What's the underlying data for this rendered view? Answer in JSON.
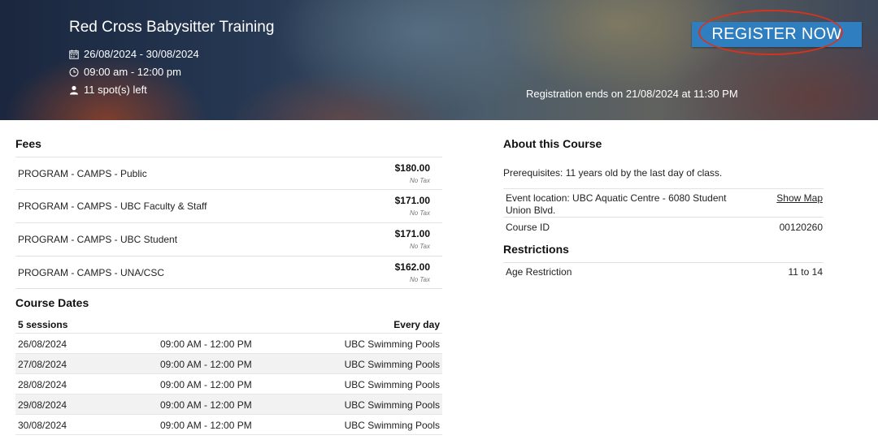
{
  "header": {
    "title": "Red Cross Babysitter Training",
    "dates": "26/08/2024 - 30/08/2024",
    "time": "09:00 am - 12:00 pm",
    "spots": "11 spot(s) left",
    "register_label": "REGISTER NOW",
    "registration_ends": "Registration ends on 21/08/2024 at 11:30 PM",
    "icons": [
      "calendar-icon",
      "clock-icon",
      "person-icon"
    ]
  },
  "fees": {
    "title": "Fees",
    "rows": [
      {
        "name": "PROGRAM - CAMPS - Public",
        "price": "$180.00",
        "tax": "No Tax"
      },
      {
        "name": "PROGRAM - CAMPS - UBC Faculty & Staff",
        "price": "$171.00",
        "tax": "No Tax"
      },
      {
        "name": "PROGRAM - CAMPS - UBC Student",
        "price": "$171.00",
        "tax": "No Tax"
      },
      {
        "name": "PROGRAM - CAMPS - UNA/CSC",
        "price": "$162.00",
        "tax": "No Tax"
      }
    ]
  },
  "course_dates": {
    "title": "Course Dates",
    "sessions": "5 sessions",
    "frequency": "Every day",
    "rows": [
      {
        "date": "26/08/2024",
        "time": "09:00 AM - 12:00 PM",
        "location": "UBC Swimming Pools"
      },
      {
        "date": "27/08/2024",
        "time": "09:00 AM - 12:00 PM",
        "location": "UBC Swimming Pools"
      },
      {
        "date": "28/08/2024",
        "time": "09:00 AM - 12:00 PM",
        "location": "UBC Swimming Pools"
      },
      {
        "date": "29/08/2024",
        "time": "09:00 AM - 12:00 PM",
        "location": "UBC Swimming Pools"
      },
      {
        "date": "30/08/2024",
        "time": "09:00 AM - 12:00 PM",
        "location": "UBC Swimming Pools"
      }
    ]
  },
  "about": {
    "title": "About this Course",
    "prerequisites": "Prerequisites: 11 years old by the last day of class.",
    "event_location": "Event location: UBC Aquatic Centre - 6080 Student Union Blvd.",
    "show_map": "Show Map",
    "course_id_label": "Course ID",
    "course_id": "00120260"
  },
  "restrictions": {
    "title": "Restrictions",
    "age_label": "Age Restriction",
    "age_value": "11 to 14"
  },
  "colors": {
    "register_button": "#2f7fc0",
    "annotation_circle": "#d6331f"
  }
}
